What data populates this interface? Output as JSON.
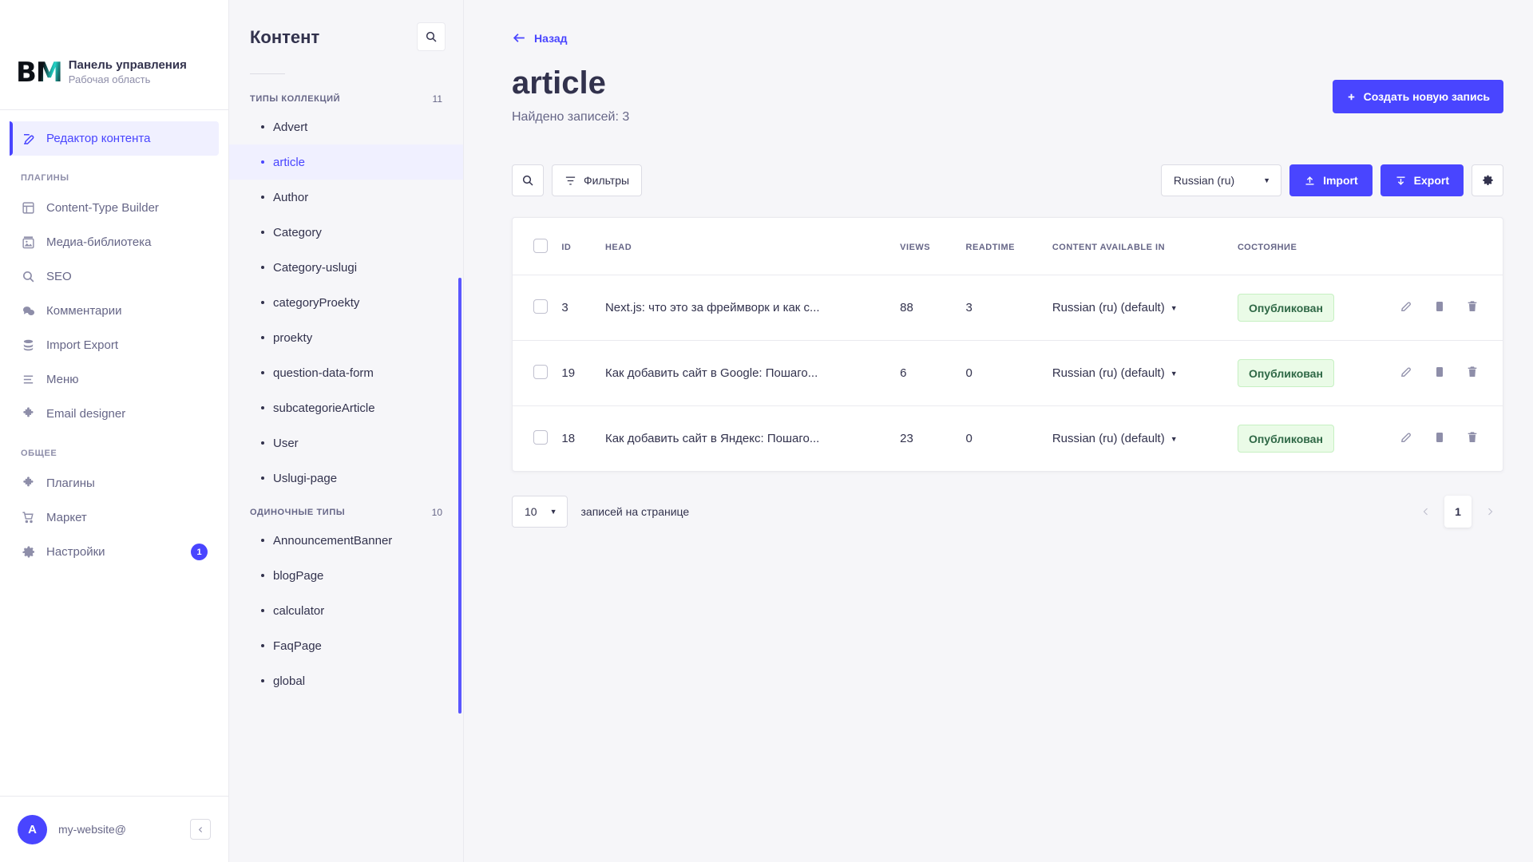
{
  "brand": {
    "logo_text": "BM",
    "title": "Панель управления",
    "subtitle": "Рабочая область"
  },
  "sidebar": {
    "main_item": {
      "label": "Редактор контента",
      "icon": "pencil-square-icon"
    },
    "plugins_section": "ПЛАГИНЫ",
    "plugins": [
      {
        "label": "Content-Type Builder",
        "icon": "layout-icon"
      },
      {
        "label": "Медиа-библиотека",
        "icon": "image-icon"
      },
      {
        "label": "SEO",
        "icon": "search-icon"
      },
      {
        "label": "Комментарии",
        "icon": "comments-icon"
      },
      {
        "label": "Import Export",
        "icon": "database-icon"
      },
      {
        "label": "Меню",
        "icon": "list-icon"
      },
      {
        "label": "Email designer",
        "icon": "puzzle-icon"
      }
    ],
    "general_section": "ОБЩЕЕ",
    "general": [
      {
        "label": "Плагины",
        "icon": "puzzle-icon",
        "badge": ""
      },
      {
        "label": "Маркет",
        "icon": "cart-icon",
        "badge": ""
      },
      {
        "label": "Настройки",
        "icon": "gear-icon",
        "badge": "1"
      }
    ],
    "user": {
      "initial": "A",
      "name": "my-website@",
      "collapse_icon": "chevron-left-icon"
    }
  },
  "content_panel": {
    "title": "Контент",
    "search_icon": "search-icon",
    "collection_section": {
      "label": "ТИПЫ КОЛЛЕКЦИЙ",
      "count": "11"
    },
    "collections": [
      {
        "label": "Advert",
        "active": false
      },
      {
        "label": "article",
        "active": true
      },
      {
        "label": "Author",
        "active": false
      },
      {
        "label": "Category",
        "active": false
      },
      {
        "label": "Category-uslugi",
        "active": false
      },
      {
        "label": "categoryProekty",
        "active": false
      },
      {
        "label": "proekty",
        "active": false
      },
      {
        "label": "question-data-form",
        "active": false
      },
      {
        "label": "subcategorieArticle",
        "active": false
      },
      {
        "label": "User",
        "active": false
      },
      {
        "label": "Uslugi-page",
        "active": false
      }
    ],
    "single_section": {
      "label": "ОДИНОЧНЫЕ ТИПЫ",
      "count": "10"
    },
    "singles": [
      {
        "label": "AnnouncementBanner",
        "active": false
      },
      {
        "label": "blogPage",
        "active": false
      },
      {
        "label": "calculator",
        "active": false
      },
      {
        "label": "FaqPage",
        "active": false
      },
      {
        "label": "global",
        "active": false
      }
    ]
  },
  "main": {
    "back_label": "Назад",
    "back_icon": "arrow-left-icon",
    "page_title": "article",
    "records_found": "Найдено записей: 3",
    "create_button": {
      "label": "Создать новую запись",
      "icon": "plus-icon"
    },
    "toolbar": {
      "search_icon": "search-icon",
      "filters_label": "Фильтры",
      "filters_icon": "filter-icon",
      "locale_value": "Russian (ru)",
      "import_label": "Import",
      "import_icon": "upload-icon",
      "export_label": "Export",
      "export_icon": "download-icon",
      "settings_icon": "gear-icon"
    },
    "table": {
      "columns": [
        "ID",
        "HEAD",
        "VIEWS",
        "READTIME",
        "CONTENT AVAILABLE IN",
        "СОСТОЯНИЕ"
      ],
      "rows": [
        {
          "id": "3",
          "head": "Next.js: что это за фреймворк и как с...",
          "views": "88",
          "readtime": "3",
          "available_in": "Russian (ru) (default)",
          "state": "Опубликован"
        },
        {
          "id": "19",
          "head": "Как добавить сайт в Google: Пошаго...",
          "views": "6",
          "readtime": "0",
          "available_in": "Russian (ru) (default)",
          "state": "Опубликован"
        },
        {
          "id": "18",
          "head": "Как добавить сайт в Яндекс: Пошаго...",
          "views": "23",
          "readtime": "0",
          "available_in": "Russian (ru) (default)",
          "state": "Опубликован"
        }
      ],
      "row_actions": [
        "edit-icon",
        "duplicate-icon",
        "delete-icon"
      ]
    },
    "pagination": {
      "per_page_value": "10",
      "per_page_label": "записей на странице",
      "prev_icon": "chevron-left-icon",
      "next_icon": "chevron-right-icon",
      "current_page": "1"
    }
  },
  "colors": {
    "accent": "#4945ff",
    "accent_light": "#f0f0ff",
    "success_bg": "#eafbe7",
    "success_text": "#2f6846",
    "neutral_text": "#32324d",
    "muted_text": "#666687",
    "page_bg": "#f6f6f9"
  }
}
